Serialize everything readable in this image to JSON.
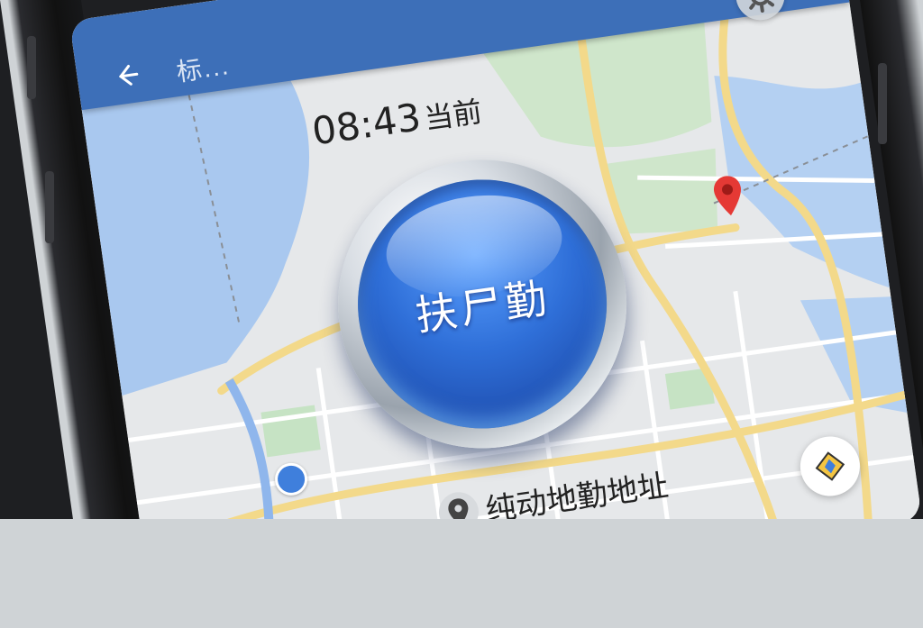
{
  "header": {
    "back_icon": "back-arrow-icon",
    "title": "标..."
  },
  "status": {
    "time": "08:43",
    "time_suffix": "当前"
  },
  "checkin_button": {
    "label": "扶尸勤"
  },
  "address": {
    "label": "纯动地勤地址",
    "icon": "location-pin-icon"
  },
  "controls": {
    "settings_icon": "gear-icon",
    "locate_icon": "navigation-icon"
  },
  "colors": {
    "header": "#3d6fb8",
    "button": "#2f6fd8",
    "marker": "#e53935",
    "water": "#a9c8ef",
    "park": "#c6e3c4",
    "road": "#f3d98a"
  }
}
